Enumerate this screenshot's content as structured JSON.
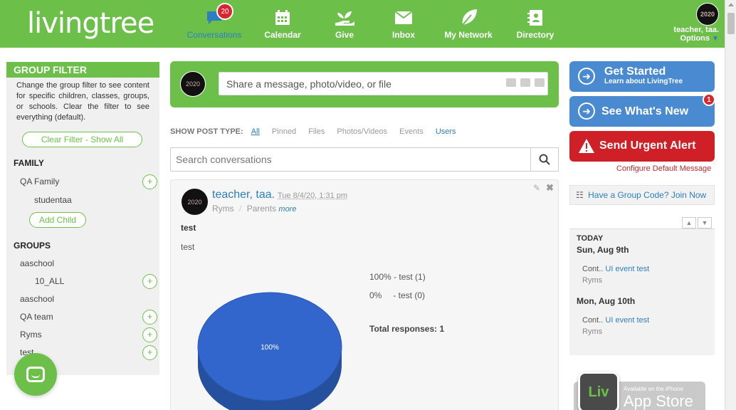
{
  "header": {
    "logo": "livingtree",
    "nav": [
      {
        "label": "Conversations",
        "icon": "chat-bubble-icon",
        "badge": "20",
        "active": true
      },
      {
        "label": "Calendar",
        "icon": "calendar-icon"
      },
      {
        "label": "Give",
        "icon": "hand-plant-icon"
      },
      {
        "label": "Inbox",
        "icon": "envelope-icon"
      },
      {
        "label": "My Network",
        "icon": "leaf-icon"
      },
      {
        "label": "Directory",
        "icon": "address-book-icon"
      }
    ],
    "user": {
      "name": "teacher, taa.",
      "options": "Options",
      "avatar_text": "2020"
    }
  },
  "sidebar": {
    "title": "GROUP FILTER",
    "description": "Change the group filter to see content for specific children, classes, groups, or schools. Clear the filter to see everything (default).",
    "clear_button": "Clear Filter - Show All",
    "family_heading": "FAMILY",
    "family_items": [
      "QA Family",
      "studentaa"
    ],
    "add_child": "Add Child",
    "groups_heading": "GROUPS",
    "groups": [
      "aaschool",
      "10_ALL",
      "aaschool",
      "QA team",
      "Ryms",
      "test"
    ]
  },
  "compose": {
    "placeholder": "Share a message, photo/video, or file",
    "avatar_text": "2020"
  },
  "post_types": {
    "label": "SHOW POST TYPE:",
    "items": [
      "All",
      "Pinned",
      "Files",
      "Photos/Videos",
      "Events",
      "Users"
    ]
  },
  "search": {
    "placeholder": "Search conversations"
  },
  "post": {
    "author": "teacher, taa.",
    "time": "Tue 8/4/20, 1:31 pm",
    "group": "Ryms",
    "separator": "/",
    "audience": "Parents",
    "more": "more",
    "title": "test",
    "body": "test",
    "avatar_text": "2020",
    "poll": [
      {
        "pct": "100%",
        "label": "- test (1)"
      },
      {
        "pct": "0%",
        "label": "- test (0)"
      }
    ],
    "total": "Total responses: 1"
  },
  "chart_data": {
    "type": "pie",
    "categories": [
      "test",
      "test"
    ],
    "values": [
      100,
      0
    ],
    "data_labels": [
      "100%"
    ],
    "colors": [
      "#3366cc"
    ]
  },
  "right": {
    "get_started": {
      "title": "Get Started",
      "subtitle": "Learn about LivingTree"
    },
    "whats_new": {
      "title": "See What's New",
      "badge": "1"
    },
    "urgent": {
      "title": "Send Urgent Alert"
    },
    "configure": "Configure Default Message",
    "group_code": "Have a Group Code? Join Now",
    "calendar": {
      "today": "TODAY",
      "days": [
        {
          "date": "Sun, Aug 9th",
          "prefix": "Cont..",
          "event": "UI event test",
          "group": "Ryms"
        },
        {
          "date": "Mon, Aug 10th",
          "prefix": "Cont..",
          "event": "UI event test",
          "group": "Ryms"
        }
      ]
    },
    "appstore": {
      "small": "Available on the iPhone",
      "big": "App Store",
      "icon_text": "Liv"
    }
  },
  "colors": {
    "brand_green": "#6cc04a",
    "link_blue": "#2e7fbd",
    "alert_red": "#d02027",
    "cta_blue": "#4a8ad0",
    "pie_blue": "#3366cc"
  }
}
